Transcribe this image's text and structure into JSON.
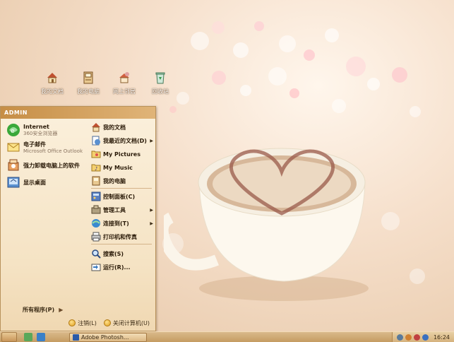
{
  "desktop_icons": [
    {
      "label": "我的文档",
      "icon": "house-icon"
    },
    {
      "label": "我的电脑",
      "icon": "computer-icon"
    },
    {
      "label": "网上邻居",
      "icon": "network-icon"
    },
    {
      "label": "回收站",
      "icon": "recycle-bin-icon"
    }
  ],
  "start_menu": {
    "user": "ADMIN",
    "pinned": [
      {
        "title": "Internet",
        "subtitle": "360安全浏览器",
        "icon": "browser-icon"
      },
      {
        "title": "电子邮件",
        "subtitle": "Microsoft Office Outlook",
        "icon": "mail-icon"
      },
      {
        "title": "强力卸载电脑上的软件",
        "subtitle": "",
        "icon": "uninstall-icon"
      },
      {
        "title": "显示桌面",
        "subtitle": "",
        "icon": "show-desktop-icon"
      }
    ],
    "places": [
      {
        "label": "我的文档",
        "icon": "my-documents-icon",
        "arrow": false
      },
      {
        "label": "我最近的文档(D)",
        "icon": "recent-documents-icon",
        "arrow": true
      },
      {
        "label": "My Pictures",
        "icon": "pictures-folder-icon",
        "arrow": false
      },
      {
        "label": "My Music",
        "icon": "music-folder-icon",
        "arrow": false
      },
      {
        "label": "我的电脑",
        "icon": "my-computer-icon",
        "arrow": false
      },
      {
        "label": "控制面板(C)",
        "icon": "control-panel-icon",
        "arrow": false
      },
      {
        "label": "管理工具",
        "icon": "admin-tools-icon",
        "arrow": true
      },
      {
        "label": "连接到(T)",
        "icon": "connect-icon",
        "arrow": true
      },
      {
        "label": "打印机和传真",
        "icon": "printer-icon",
        "arrow": false
      },
      {
        "label": "搜索(S)",
        "icon": "search-icon",
        "arrow": false
      },
      {
        "label": "运行(R)...",
        "icon": "run-icon",
        "arrow": false
      }
    ],
    "all_programs": "所有程序(P)",
    "logoff": "注销(L)",
    "shutdown": "关闭计算机(U)"
  },
  "taskbar": {
    "task_label": "Adobe Photosh...",
    "clock": "16:24"
  },
  "colors": {
    "accent": "#c68e46",
    "taskbar": "#c59c62",
    "menu_bg": "#fbf0dc"
  }
}
